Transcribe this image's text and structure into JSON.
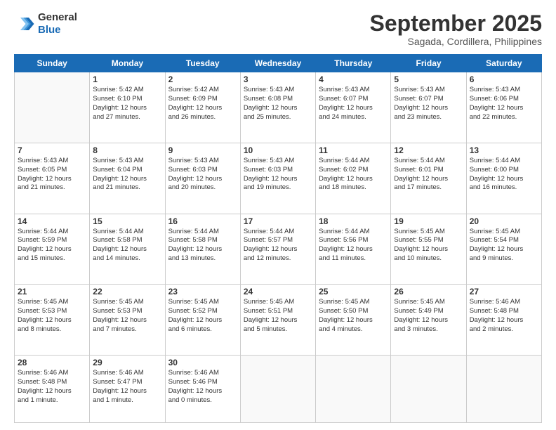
{
  "header": {
    "logo_line1": "General",
    "logo_line2": "Blue",
    "month": "September 2025",
    "location": "Sagada, Cordillera, Philippines"
  },
  "days_of_week": [
    "Sunday",
    "Monday",
    "Tuesday",
    "Wednesday",
    "Thursday",
    "Friday",
    "Saturday"
  ],
  "weeks": [
    [
      {
        "day": "",
        "info": ""
      },
      {
        "day": "1",
        "info": "Sunrise: 5:42 AM\nSunset: 6:10 PM\nDaylight: 12 hours\nand 27 minutes."
      },
      {
        "day": "2",
        "info": "Sunrise: 5:42 AM\nSunset: 6:09 PM\nDaylight: 12 hours\nand 26 minutes."
      },
      {
        "day": "3",
        "info": "Sunrise: 5:43 AM\nSunset: 6:08 PM\nDaylight: 12 hours\nand 25 minutes."
      },
      {
        "day": "4",
        "info": "Sunrise: 5:43 AM\nSunset: 6:07 PM\nDaylight: 12 hours\nand 24 minutes."
      },
      {
        "day": "5",
        "info": "Sunrise: 5:43 AM\nSunset: 6:07 PM\nDaylight: 12 hours\nand 23 minutes."
      },
      {
        "day": "6",
        "info": "Sunrise: 5:43 AM\nSunset: 6:06 PM\nDaylight: 12 hours\nand 22 minutes."
      }
    ],
    [
      {
        "day": "7",
        "info": "Sunrise: 5:43 AM\nSunset: 6:05 PM\nDaylight: 12 hours\nand 21 minutes."
      },
      {
        "day": "8",
        "info": "Sunrise: 5:43 AM\nSunset: 6:04 PM\nDaylight: 12 hours\nand 21 minutes."
      },
      {
        "day": "9",
        "info": "Sunrise: 5:43 AM\nSunset: 6:03 PM\nDaylight: 12 hours\nand 20 minutes."
      },
      {
        "day": "10",
        "info": "Sunrise: 5:43 AM\nSunset: 6:03 PM\nDaylight: 12 hours\nand 19 minutes."
      },
      {
        "day": "11",
        "info": "Sunrise: 5:44 AM\nSunset: 6:02 PM\nDaylight: 12 hours\nand 18 minutes."
      },
      {
        "day": "12",
        "info": "Sunrise: 5:44 AM\nSunset: 6:01 PM\nDaylight: 12 hours\nand 17 minutes."
      },
      {
        "day": "13",
        "info": "Sunrise: 5:44 AM\nSunset: 6:00 PM\nDaylight: 12 hours\nand 16 minutes."
      }
    ],
    [
      {
        "day": "14",
        "info": "Sunrise: 5:44 AM\nSunset: 5:59 PM\nDaylight: 12 hours\nand 15 minutes."
      },
      {
        "day": "15",
        "info": "Sunrise: 5:44 AM\nSunset: 5:58 PM\nDaylight: 12 hours\nand 14 minutes."
      },
      {
        "day": "16",
        "info": "Sunrise: 5:44 AM\nSunset: 5:58 PM\nDaylight: 12 hours\nand 13 minutes."
      },
      {
        "day": "17",
        "info": "Sunrise: 5:44 AM\nSunset: 5:57 PM\nDaylight: 12 hours\nand 12 minutes."
      },
      {
        "day": "18",
        "info": "Sunrise: 5:44 AM\nSunset: 5:56 PM\nDaylight: 12 hours\nand 11 minutes."
      },
      {
        "day": "19",
        "info": "Sunrise: 5:45 AM\nSunset: 5:55 PM\nDaylight: 12 hours\nand 10 minutes."
      },
      {
        "day": "20",
        "info": "Sunrise: 5:45 AM\nSunset: 5:54 PM\nDaylight: 12 hours\nand 9 minutes."
      }
    ],
    [
      {
        "day": "21",
        "info": "Sunrise: 5:45 AM\nSunset: 5:53 PM\nDaylight: 12 hours\nand 8 minutes."
      },
      {
        "day": "22",
        "info": "Sunrise: 5:45 AM\nSunset: 5:53 PM\nDaylight: 12 hours\nand 7 minutes."
      },
      {
        "day": "23",
        "info": "Sunrise: 5:45 AM\nSunset: 5:52 PM\nDaylight: 12 hours\nand 6 minutes."
      },
      {
        "day": "24",
        "info": "Sunrise: 5:45 AM\nSunset: 5:51 PM\nDaylight: 12 hours\nand 5 minutes."
      },
      {
        "day": "25",
        "info": "Sunrise: 5:45 AM\nSunset: 5:50 PM\nDaylight: 12 hours\nand 4 minutes."
      },
      {
        "day": "26",
        "info": "Sunrise: 5:45 AM\nSunset: 5:49 PM\nDaylight: 12 hours\nand 3 minutes."
      },
      {
        "day": "27",
        "info": "Sunrise: 5:46 AM\nSunset: 5:48 PM\nDaylight: 12 hours\nand 2 minutes."
      }
    ],
    [
      {
        "day": "28",
        "info": "Sunrise: 5:46 AM\nSunset: 5:48 PM\nDaylight: 12 hours\nand 1 minute."
      },
      {
        "day": "29",
        "info": "Sunrise: 5:46 AM\nSunset: 5:47 PM\nDaylight: 12 hours\nand 1 minute."
      },
      {
        "day": "30",
        "info": "Sunrise: 5:46 AM\nSunset: 5:46 PM\nDaylight: 12 hours\nand 0 minutes."
      },
      {
        "day": "",
        "info": ""
      },
      {
        "day": "",
        "info": ""
      },
      {
        "day": "",
        "info": ""
      },
      {
        "day": "",
        "info": ""
      }
    ]
  ]
}
